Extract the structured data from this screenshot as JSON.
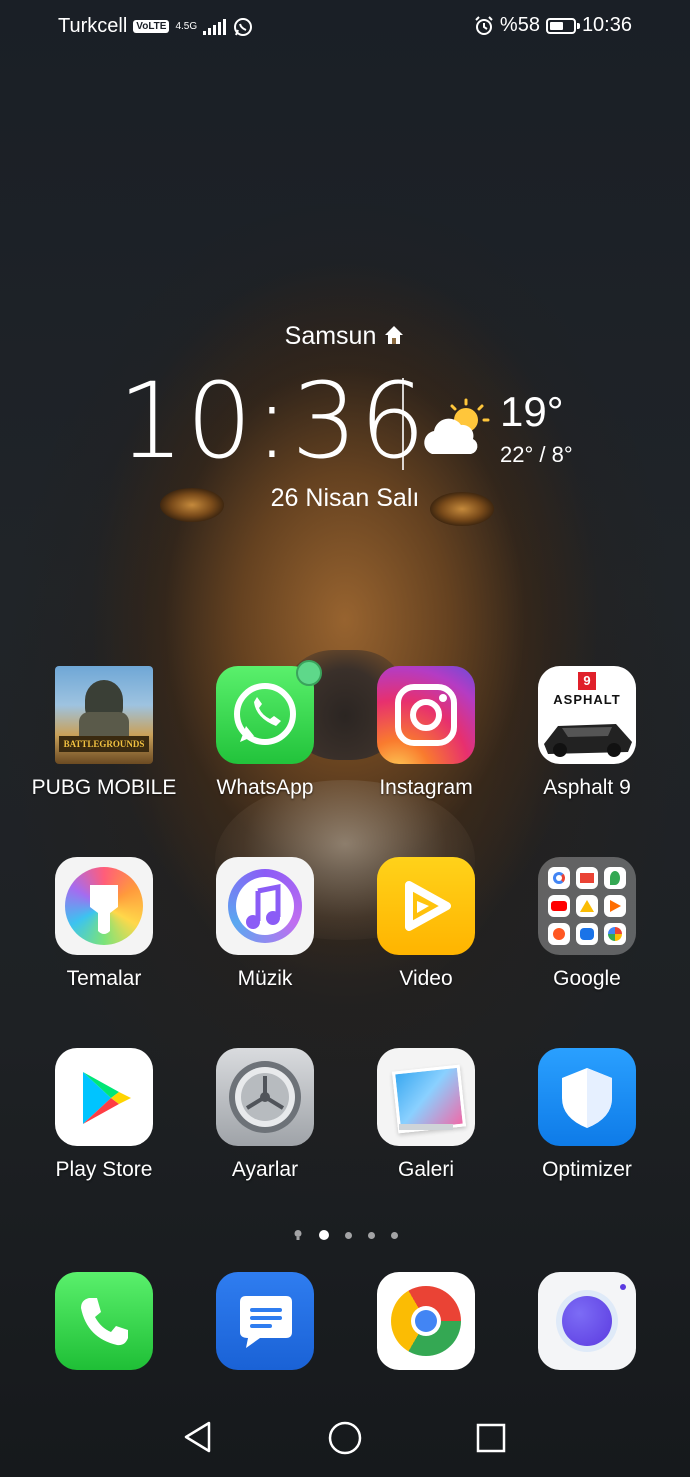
{
  "status_bar": {
    "carrier": "Turkcell",
    "volte": "VoLTE",
    "network": "4.5G",
    "battery_percent": "%58",
    "time": "10:36",
    "battery_level": 0.58
  },
  "widget": {
    "city": "Samsun",
    "time": "10:36",
    "temperature": "19°",
    "range": "22° / 8°",
    "date": "26 Nisan Salı"
  },
  "apps": [
    {
      "label": "PUBG MOBILE"
    },
    {
      "label": "WhatsApp"
    },
    {
      "label": "Instagram"
    },
    {
      "label": "Asphalt 9"
    },
    {
      "label": "Temalar"
    },
    {
      "label": "Müzik"
    },
    {
      "label": "Video"
    },
    {
      "label": "Google"
    },
    {
      "label": "Play Store"
    },
    {
      "label": "Ayarlar"
    },
    {
      "label": "Galeri"
    },
    {
      "label": "Optimizer"
    }
  ],
  "icon_text": {
    "pubg": "BATTLEGROUNDS",
    "asphalt_number": "9",
    "asphalt_word": "ASPHALT"
  },
  "dock": [
    "phone-icon",
    "messages-icon",
    "chrome-icon",
    "browser-icon"
  ],
  "pages": {
    "count": 4,
    "active": 1
  }
}
